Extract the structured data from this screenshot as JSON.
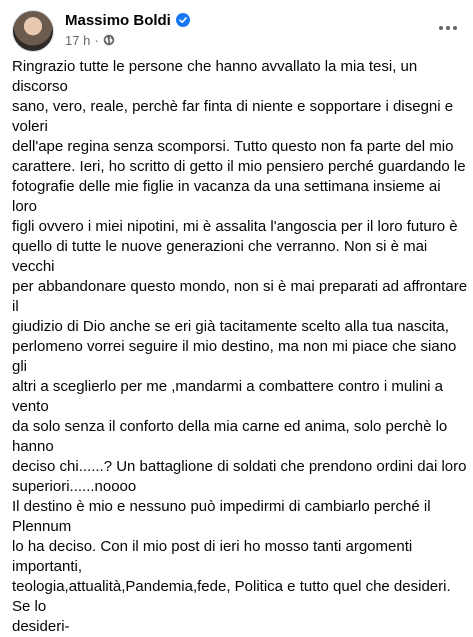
{
  "post": {
    "author": "Massimo Boldi",
    "time": "17 h",
    "separator": "·",
    "audience_icon": "globe-icon",
    "more_icon": "more-options-icon",
    "verified_icon": "verified-badge-icon",
    "paragraph_1": "Ringrazio tutte le persone che hanno avvallato la mia tesi, un discorso\nsano, vero, reale, perchè far finta di niente e sopportare i disegni e voleri\ndell'ape regina senza scomporsi. Tutto questo non fa parte del mio\ncarattere. Ieri, ho scritto di getto il mio pensiero perché guardando le\nfotografie delle mie figlie in vacanza da una settimana insieme ai loro\nfigli ovvero i miei nipotini, mi è assalita l'angoscia per il loro futuro è\nquello di tutte le nuove generazioni che verranno. Non si è mai vecchi\nper abbandonare questo mondo, non si è mai preparati ad affrontare il\ngiudizio di Dio anche se eri già tacitamente scelto alla tua nascita,\nperlomeno vorrei seguire il mio destino, ma non mi piace che siano gli\naltri a sceglierlo per me ,mandarmi a combattere contro i mulini a vento\nda solo senza il conforto della mia carne ed anima, solo perchè lo hanno\ndeciso chi......? Un battaglione di soldati che prendono ordini dai loro\nsuperiori......noooo",
    "paragraph_2": "Il destino è mio e nessuno può impedirmi di cambiarlo perché il Plennum\nlo ha deciso. Con il mio post di ieri ho mosso tanti argomenti importanti,\nteologia,attualità,Pandemia,fede, Politica e tutto quel che desideri. Se lo\ndesideri-"
  },
  "colors": {
    "text": "#050505",
    "meta": "#65676b",
    "verified": "#1877f2"
  }
}
